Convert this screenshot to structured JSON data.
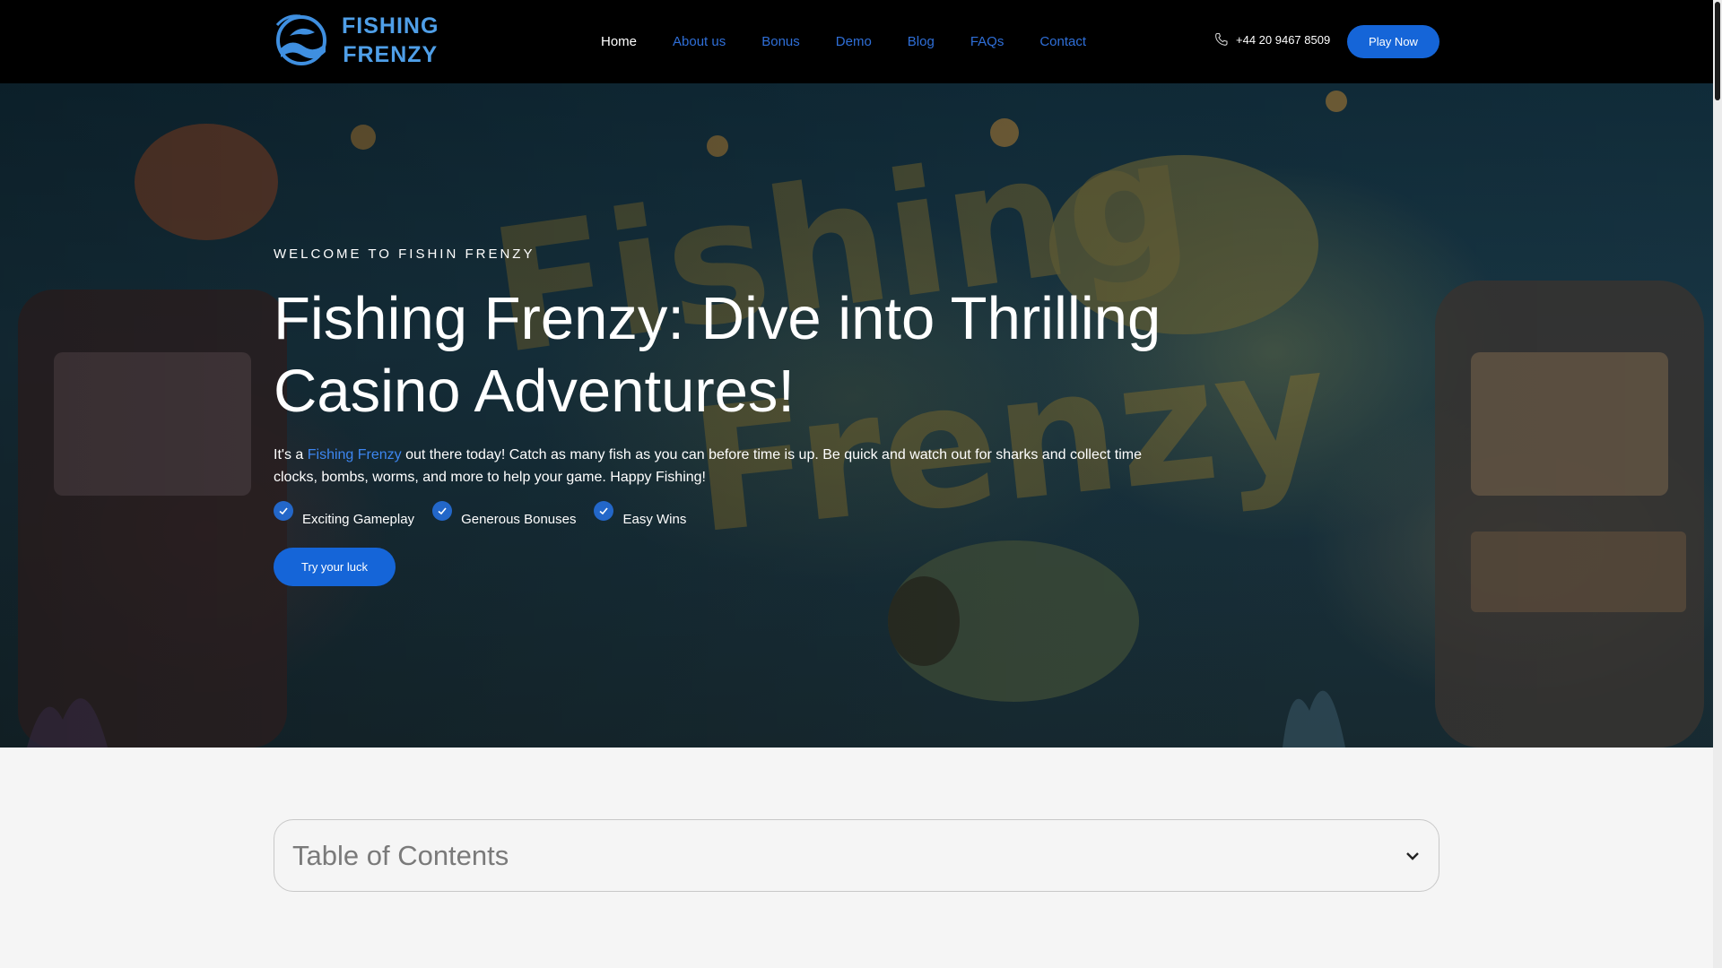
{
  "brand": {
    "name_line1": "FISHING",
    "name_line2": "FRENZY",
    "logo_icon": "fish-wave-logo-icon",
    "color": "#4f9fe8"
  },
  "nav": {
    "items": [
      {
        "label": "Home",
        "active": true
      },
      {
        "label": "About us",
        "active": false
      },
      {
        "label": "Bonus",
        "active": false
      },
      {
        "label": "Demo",
        "active": false
      },
      {
        "label": "Blog",
        "active": false
      },
      {
        "label": "FAQs",
        "active": false
      },
      {
        "label": "Contact",
        "active": false
      }
    ],
    "phone": "+44 20 9467 8509",
    "phone_icon": "phone-icon",
    "cta_label": "Play Now"
  },
  "hero": {
    "eyebrow": "WELCOME TO FISHIN FRENZY",
    "title": "Fishing Frenzy: Dive into Thrilling Casino Adventures!",
    "desc_prefix": "It's a ",
    "desc_link": "Fishing Frenzy",
    "desc_suffix": " out there today! Catch as many fish as you can before time is up. Be quick and watch out for sharks and collect time clocks, bombs, worms, and more to help your game. Happy Fishing!",
    "features": [
      "Exciting Gameplay",
      "Generous Bonuses",
      "Easy Wins"
    ],
    "feature_icon": "check-circle-icon",
    "cta_label": "Try your luck"
  },
  "toc": {
    "title": "Table of Contents",
    "icon": "chevron-down-icon"
  },
  "colors": {
    "accent": "#1565d8",
    "link": "#2f6fd8",
    "header_bg": "#000000",
    "page_bg": "#f5f5f5"
  }
}
